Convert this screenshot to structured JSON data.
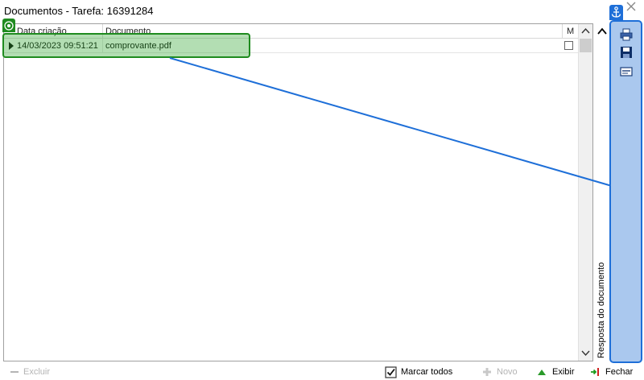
{
  "window": {
    "title": "Documentos - Tarefa: 16391284"
  },
  "grid": {
    "columns": [
      "Data criação",
      "Documento",
      "M"
    ],
    "rows": [
      {
        "data_criacao": "14/03/2023 09:51:21",
        "documento": "comprovante.pdf",
        "marcado": false
      }
    ]
  },
  "side_panel": {
    "vertical_label": "Resposta do documento",
    "tools": [
      "print-icon",
      "save-icon",
      "scan-icon"
    ]
  },
  "toolbar": {
    "excluir_label": "Excluir",
    "marcar_todos_label": "Marcar todos",
    "novo_label": "Novo",
    "exibir_label": "Exibir",
    "fechar_label": "Fechar"
  },
  "colors": {
    "highlight_green": "#1f8b1f",
    "panel_blue": "#1e6fd8",
    "panel_fill": "#aac8ee",
    "disabled_text": "#b4b4b4"
  }
}
